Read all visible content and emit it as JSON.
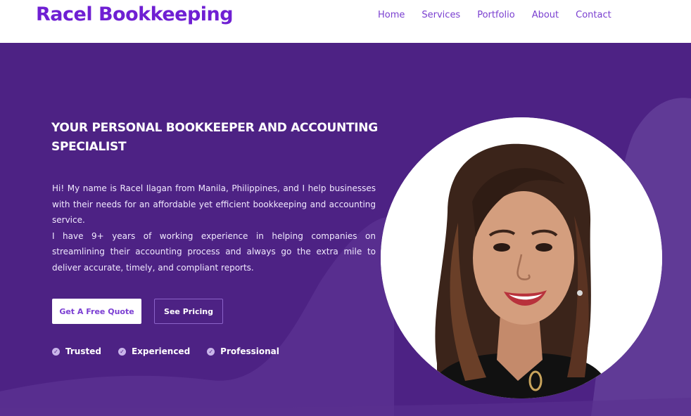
{
  "brand": {
    "name": "Racel Bookkeeping",
    "accent": "#6f1fd3"
  },
  "nav": {
    "items": [
      {
        "label": "Home"
      },
      {
        "label": "Services"
      },
      {
        "label": "Portfolio"
      },
      {
        "label": "About"
      },
      {
        "label": "Contact"
      }
    ]
  },
  "hero": {
    "background": "#4d2284",
    "headline": "YOUR PERSONAL BOOKKEEPER AND ACCOUNTING SPECIALIST",
    "intro_1": "Hi! My name is Racel Ilagan from Manila, Philippines, and I help businesses with their needs for an affordable yet efficient bookkeeping and accounting service.",
    "intro_2": "I have 9+ years of working experience in helping companies on streamlining their accounting process and always go the extra mile to deliver accurate, timely, and compliant reports.",
    "primary_button": "Get A Free Quote",
    "secondary_button": "See Pricing",
    "badges": [
      {
        "label": "Trusted",
        "icon": "check-circle-icon"
      },
      {
        "label": "Experienced",
        "icon": "check-circle-icon"
      },
      {
        "label": "Professional",
        "icon": "check-circle-icon"
      }
    ]
  }
}
